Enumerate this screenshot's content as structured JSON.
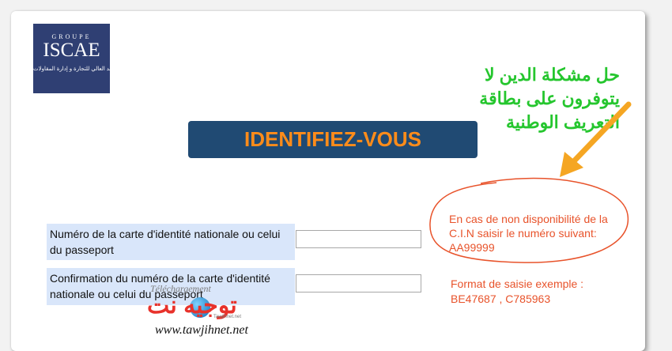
{
  "logo": {
    "groupe": "GROUPE",
    "name": "ISCAE",
    "subtitle": "المعهد العالي للتجارة و إدارة المقاولات"
  },
  "page_title": "IDENTIFIEZ-VOUS",
  "annotation": {
    "arabic_note": "حل مشكلة الدين لا يتوفرون على بطاقة التعريف الوطنية",
    "red_note": "En cas de non disponibilité de la C.I.N saisir le numéro suivant: AA99999",
    "colors": {
      "arabic_note": "#25c62e",
      "red_note": "#e8532b",
      "arrow": "#f5a623"
    }
  },
  "form": {
    "field1_label": "Numéro de la carte d'identité nationale ou celui du passeport",
    "field1_value": "",
    "field2_label": "Confirmation du numéro de la carte d'identité nationale ou celui du passeport",
    "field2_value": ""
  },
  "format_note": {
    "line1": "Format de saisie exemple :",
    "line2": "BE47687 ,  C785963"
  },
  "watermark": {
    "script": "Téléchargement",
    "arabic": "توجيه نت",
    "small": "Tawjihnet.net",
    "url": "www.tawjihnet.net"
  },
  "colors": {
    "title_bg": "#204a73",
    "title_text": "#ff8c1a",
    "label_bg": "#d9e6fa"
  }
}
